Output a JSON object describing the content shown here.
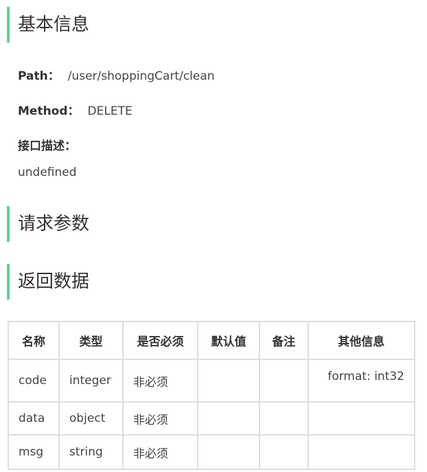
{
  "sections": {
    "basic_info": "基本信息",
    "request_params": "请求参数",
    "response_data": "返回数据"
  },
  "basic": {
    "path_label": "Path：",
    "path_value": "/user/shoppingCart/clean",
    "method_label": "Method：",
    "method_value": "DELETE",
    "desc_label": "接口描述：",
    "desc_value": "undefined"
  },
  "table": {
    "headers": [
      "名称",
      "类型",
      "是否必须",
      "默认值",
      "备注",
      "其他信息"
    ],
    "rows": [
      {
        "name": "code",
        "type": "integer",
        "required": "非必须",
        "default": "",
        "remark": "",
        "other": "format: int32"
      },
      {
        "name": "data",
        "type": "object",
        "required": "非必须",
        "default": "",
        "remark": "",
        "other": ""
      },
      {
        "name": "msg",
        "type": "string",
        "required": "非必须",
        "default": "",
        "remark": "",
        "other": ""
      }
    ]
  },
  "colors": {
    "accent": "#5fd09a",
    "border": "#dddddd",
    "text": "#333333"
  }
}
